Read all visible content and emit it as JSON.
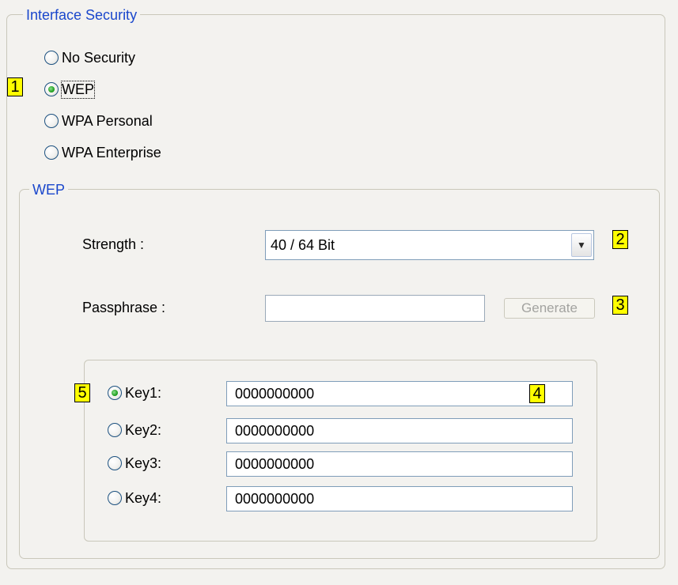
{
  "interface_security": {
    "title": "Interface Security",
    "options": [
      {
        "label": "No Security",
        "checked": false
      },
      {
        "label": "WEP",
        "checked": true
      },
      {
        "label": "WPA Personal",
        "checked": false
      },
      {
        "label": "WPA Enterprise",
        "checked": false
      }
    ]
  },
  "wep": {
    "title": "WEP",
    "strength_label": "Strength :",
    "strength_value": "40 / 64 Bit",
    "passphrase_label": "Passphrase :",
    "passphrase_value": "",
    "generate_label": "Generate",
    "keys": [
      {
        "label": "Key1:",
        "value": "0000000000",
        "checked": true
      },
      {
        "label": "Key2:",
        "value": "0000000000",
        "checked": false
      },
      {
        "label": "Key3:",
        "value": "0000000000",
        "checked": false
      },
      {
        "label": "Key4:",
        "value": "0000000000",
        "checked": false
      }
    ]
  },
  "callouts": [
    "1",
    "2",
    "3",
    "4",
    "5"
  ],
  "colors": {
    "group_title": "#1a47cc",
    "callout_bg": "#ffff00",
    "background": "#f3f2ef",
    "radio_checked": "#21a121"
  }
}
